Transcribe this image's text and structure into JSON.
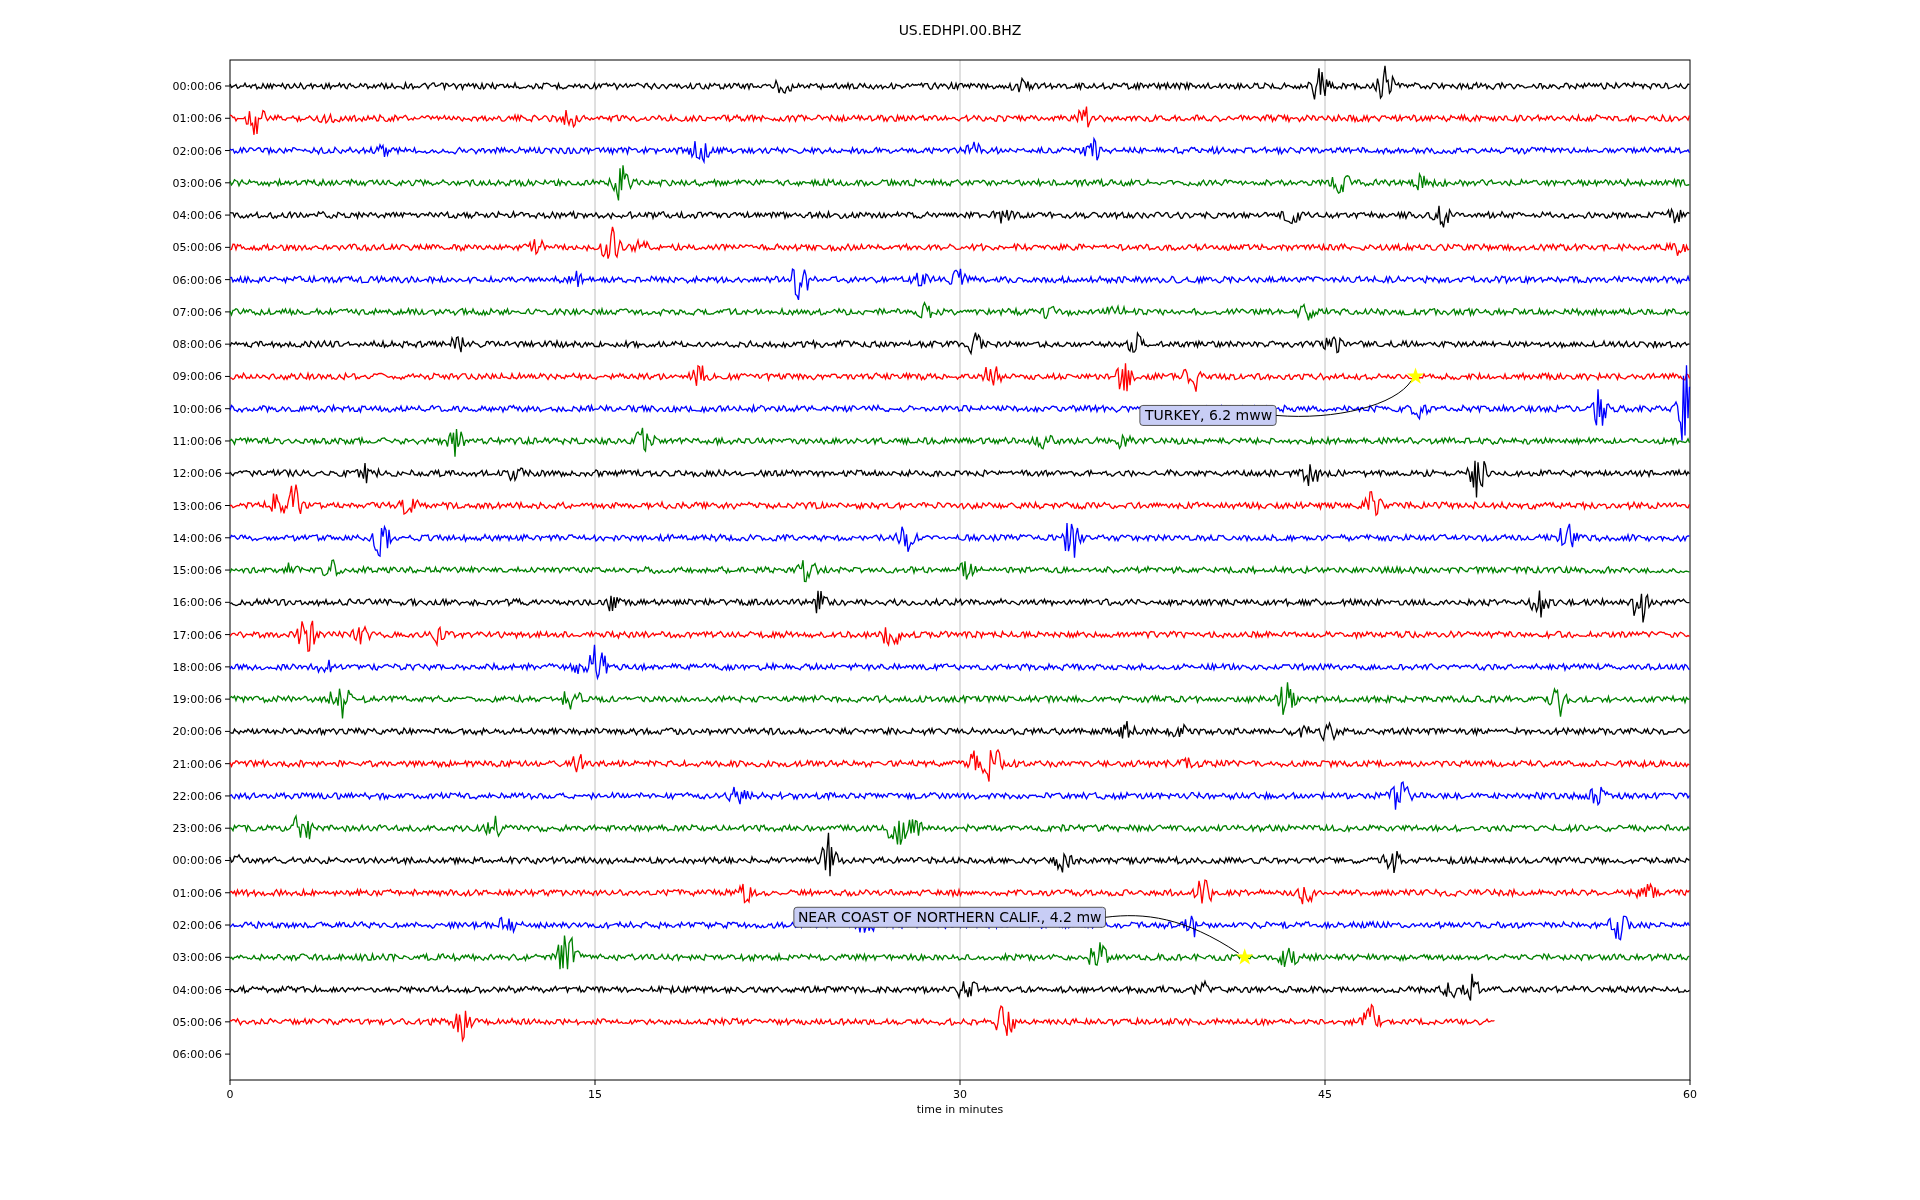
{
  "plot": {
    "title": "US.EDHPI.00.BHZ",
    "xlabel": "time in minutes",
    "xticks": [
      "0",
      "15",
      "30",
      "45",
      "60"
    ],
    "rows": [
      {
        "label": "00:00:06",
        "kind": "trace",
        "color": "#000000",
        "level": 1
      },
      {
        "label": "01:00:06",
        "kind": "trace",
        "color": "#ff0000",
        "level": 1
      },
      {
        "label": "02:00:06",
        "kind": "trace",
        "color": "#0000ff",
        "level": 1
      },
      {
        "label": "03:00:06",
        "kind": "trace",
        "color": "#008000",
        "level": 1
      },
      {
        "label": "04:00:06",
        "kind": "trace",
        "color": "#000000",
        "level": 1
      },
      {
        "label": "05:00:06",
        "kind": "trace",
        "color": "#ff0000",
        "level": 1
      },
      {
        "label": "06:00:06",
        "kind": "trace",
        "color": "#0000ff",
        "level": 1
      },
      {
        "label": "07:00:06",
        "kind": "trace",
        "color": "#008000",
        "level": 1
      },
      {
        "label": "08:00:06",
        "kind": "trace",
        "color": "#000000",
        "level": 1
      },
      {
        "label": "09:00:06",
        "kind": "trace",
        "color": "#ff0000",
        "level": 1,
        "event": "TURKEY, 6.2 mww"
      },
      {
        "label": "10:00:06",
        "kind": "trace",
        "color": "#0000ff",
        "level": 1
      },
      {
        "label": "11:00:06",
        "kind": "trace",
        "color": "#008000",
        "level": 1
      },
      {
        "label": "12:00:06",
        "kind": "trace",
        "color": "#000000",
        "level": 1
      },
      {
        "label": "13:00:06",
        "kind": "trace",
        "color": "#ff0000",
        "level": 1
      },
      {
        "label": "14:00:06",
        "kind": "trace",
        "color": "#0000ff",
        "level": 1
      },
      {
        "label": "15:00:06",
        "kind": "trace",
        "color": "#008000",
        "level": 1
      },
      {
        "label": "16:00:06",
        "kind": "trace",
        "color": "#000000",
        "level": 1
      },
      {
        "label": "17:00:06",
        "kind": "trace",
        "color": "#ff0000",
        "level": 1
      },
      {
        "label": "18:00:06",
        "kind": "trace",
        "color": "#0000ff",
        "level": 1
      },
      {
        "label": "19:00:06",
        "kind": "trace",
        "color": "#008000",
        "level": 1
      },
      {
        "label": "20:00:06",
        "kind": "trace",
        "color": "#000000",
        "level": 1
      },
      {
        "label": "21:00:06",
        "kind": "trace",
        "color": "#ff0000",
        "level": 1
      },
      {
        "label": "22:00:06",
        "kind": "trace",
        "color": "#0000ff",
        "level": 1
      },
      {
        "label": "23:00:06",
        "kind": "trace",
        "color": "#008000",
        "level": 1
      },
      {
        "label": "00:00:06",
        "kind": "trace",
        "color": "#000000",
        "level": 1
      },
      {
        "label": "01:00:06",
        "kind": "trace",
        "color": "#ff0000",
        "level": 1
      },
      {
        "label": "02:00:06",
        "kind": "trace",
        "color": "#0000ff",
        "level": 1
      },
      {
        "label": "03:00:06",
        "kind": "trace",
        "color": "#008000",
        "level": 1,
        "event": "NEAR COAST OF NORTHERN CALIF., 4.2 mw"
      },
      {
        "label": "04:00:06",
        "kind": "trace",
        "color": "#000000",
        "level": 1
      },
      {
        "label": "05:00:06",
        "kind": "trace",
        "color": "#ff0000",
        "level": 0.867
      },
      {
        "label": "06:00:06",
        "kind": "blank"
      }
    ]
  }
}
